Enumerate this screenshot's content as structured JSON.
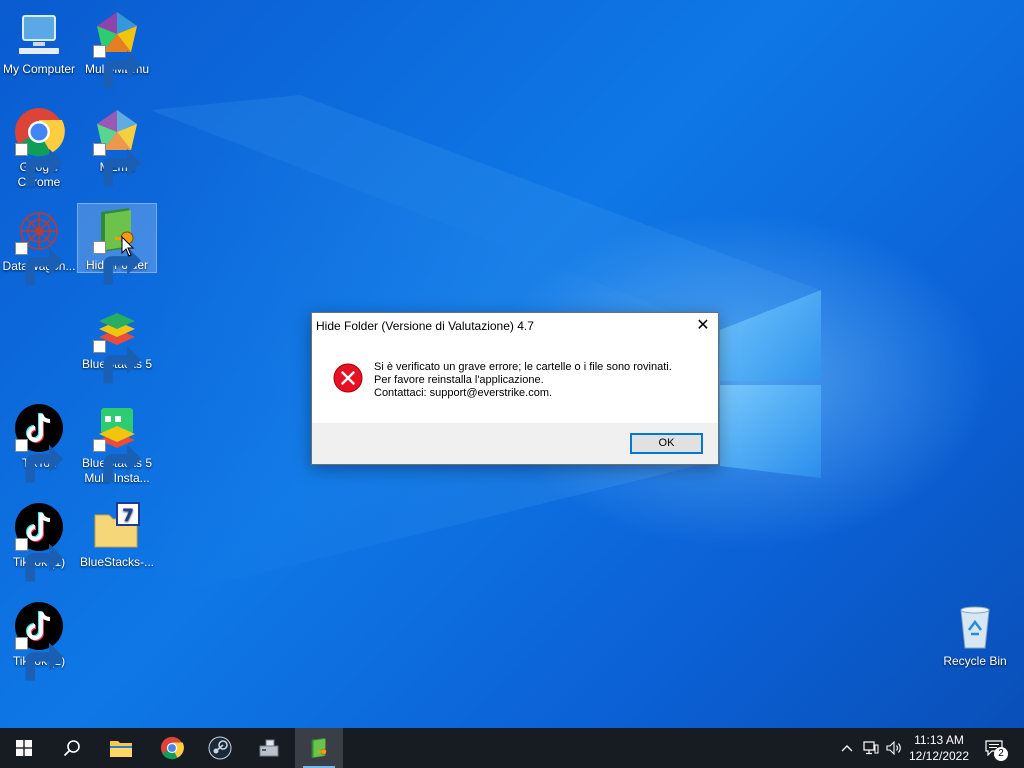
{
  "desktop": {
    "icons": [
      {
        "label": "My Computer"
      },
      {
        "label": "Multi-MEmu"
      },
      {
        "label": "Google Chrome"
      },
      {
        "label": "MEmu"
      },
      {
        "label": "DataWagon..."
      },
      {
        "label": "Hide Folder"
      },
      {
        "label": "BlueStacks 5"
      },
      {
        "label": "TikTok"
      },
      {
        "label": "BlueStacks 5 Multi-Insta..."
      },
      {
        "label": "TikTok (1)"
      },
      {
        "label": "BlueStacks-..."
      },
      {
        "label": "TikTok (2)"
      },
      {
        "label": "Recycle Bin"
      }
    ]
  },
  "dialog": {
    "title": "Hide Folder (Versione di Valutazione) 4.7",
    "close_symbol": "✕",
    "message_line1": "Si è verificato un grave errore; le cartelle o i file sono rovinati.",
    "message_line2": "Per favore reinstalla l'applicazione.",
    "message_line3": "Contattaci: support@everstrike.com.",
    "ok_label": "OK",
    "icon": "error-icon"
  },
  "taskbar": {
    "items": [
      {
        "icon": "windows-start-icon"
      },
      {
        "icon": "search-icon"
      },
      {
        "icon": "file-explorer-icon"
      },
      {
        "icon": "chrome-icon"
      },
      {
        "icon": "steam-icon"
      },
      {
        "icon": "network-app-icon"
      },
      {
        "icon": "hide-folder-icon"
      }
    ],
    "clock_time": "11:13 AM",
    "clock_date": "12/12/2022",
    "notification_count": "2"
  },
  "colors": {
    "accent": "#0078d7",
    "taskbar": "#171b22",
    "error_red": "#e81123"
  }
}
